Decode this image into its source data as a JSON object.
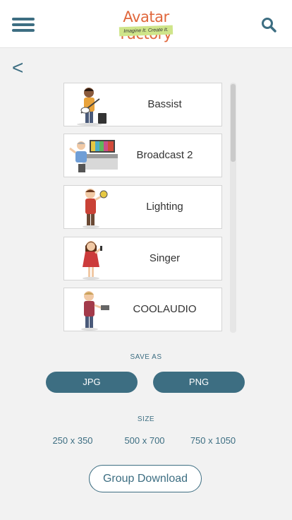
{
  "header": {
    "logo_title": "Avatar Factory",
    "logo_tagline": "Imagine It. Create It."
  },
  "nav": {
    "back_label": "<"
  },
  "avatars": [
    {
      "label": "Bassist"
    },
    {
      "label": "Broadcast 2"
    },
    {
      "label": "Lighting"
    },
    {
      "label": "Singer"
    },
    {
      "label": "COOLAUDIO"
    }
  ],
  "save_as": {
    "heading": "SAVE AS",
    "options": [
      "JPG",
      "PNG"
    ]
  },
  "size": {
    "heading": "SIZE",
    "options": [
      "250 x 350",
      "500 x 700",
      "750 x 1050"
    ]
  },
  "group_download_label": "Group Download",
  "colors": {
    "accent": "#3d6e82",
    "logo": "#e0673c",
    "background": "#f2f2f2"
  }
}
